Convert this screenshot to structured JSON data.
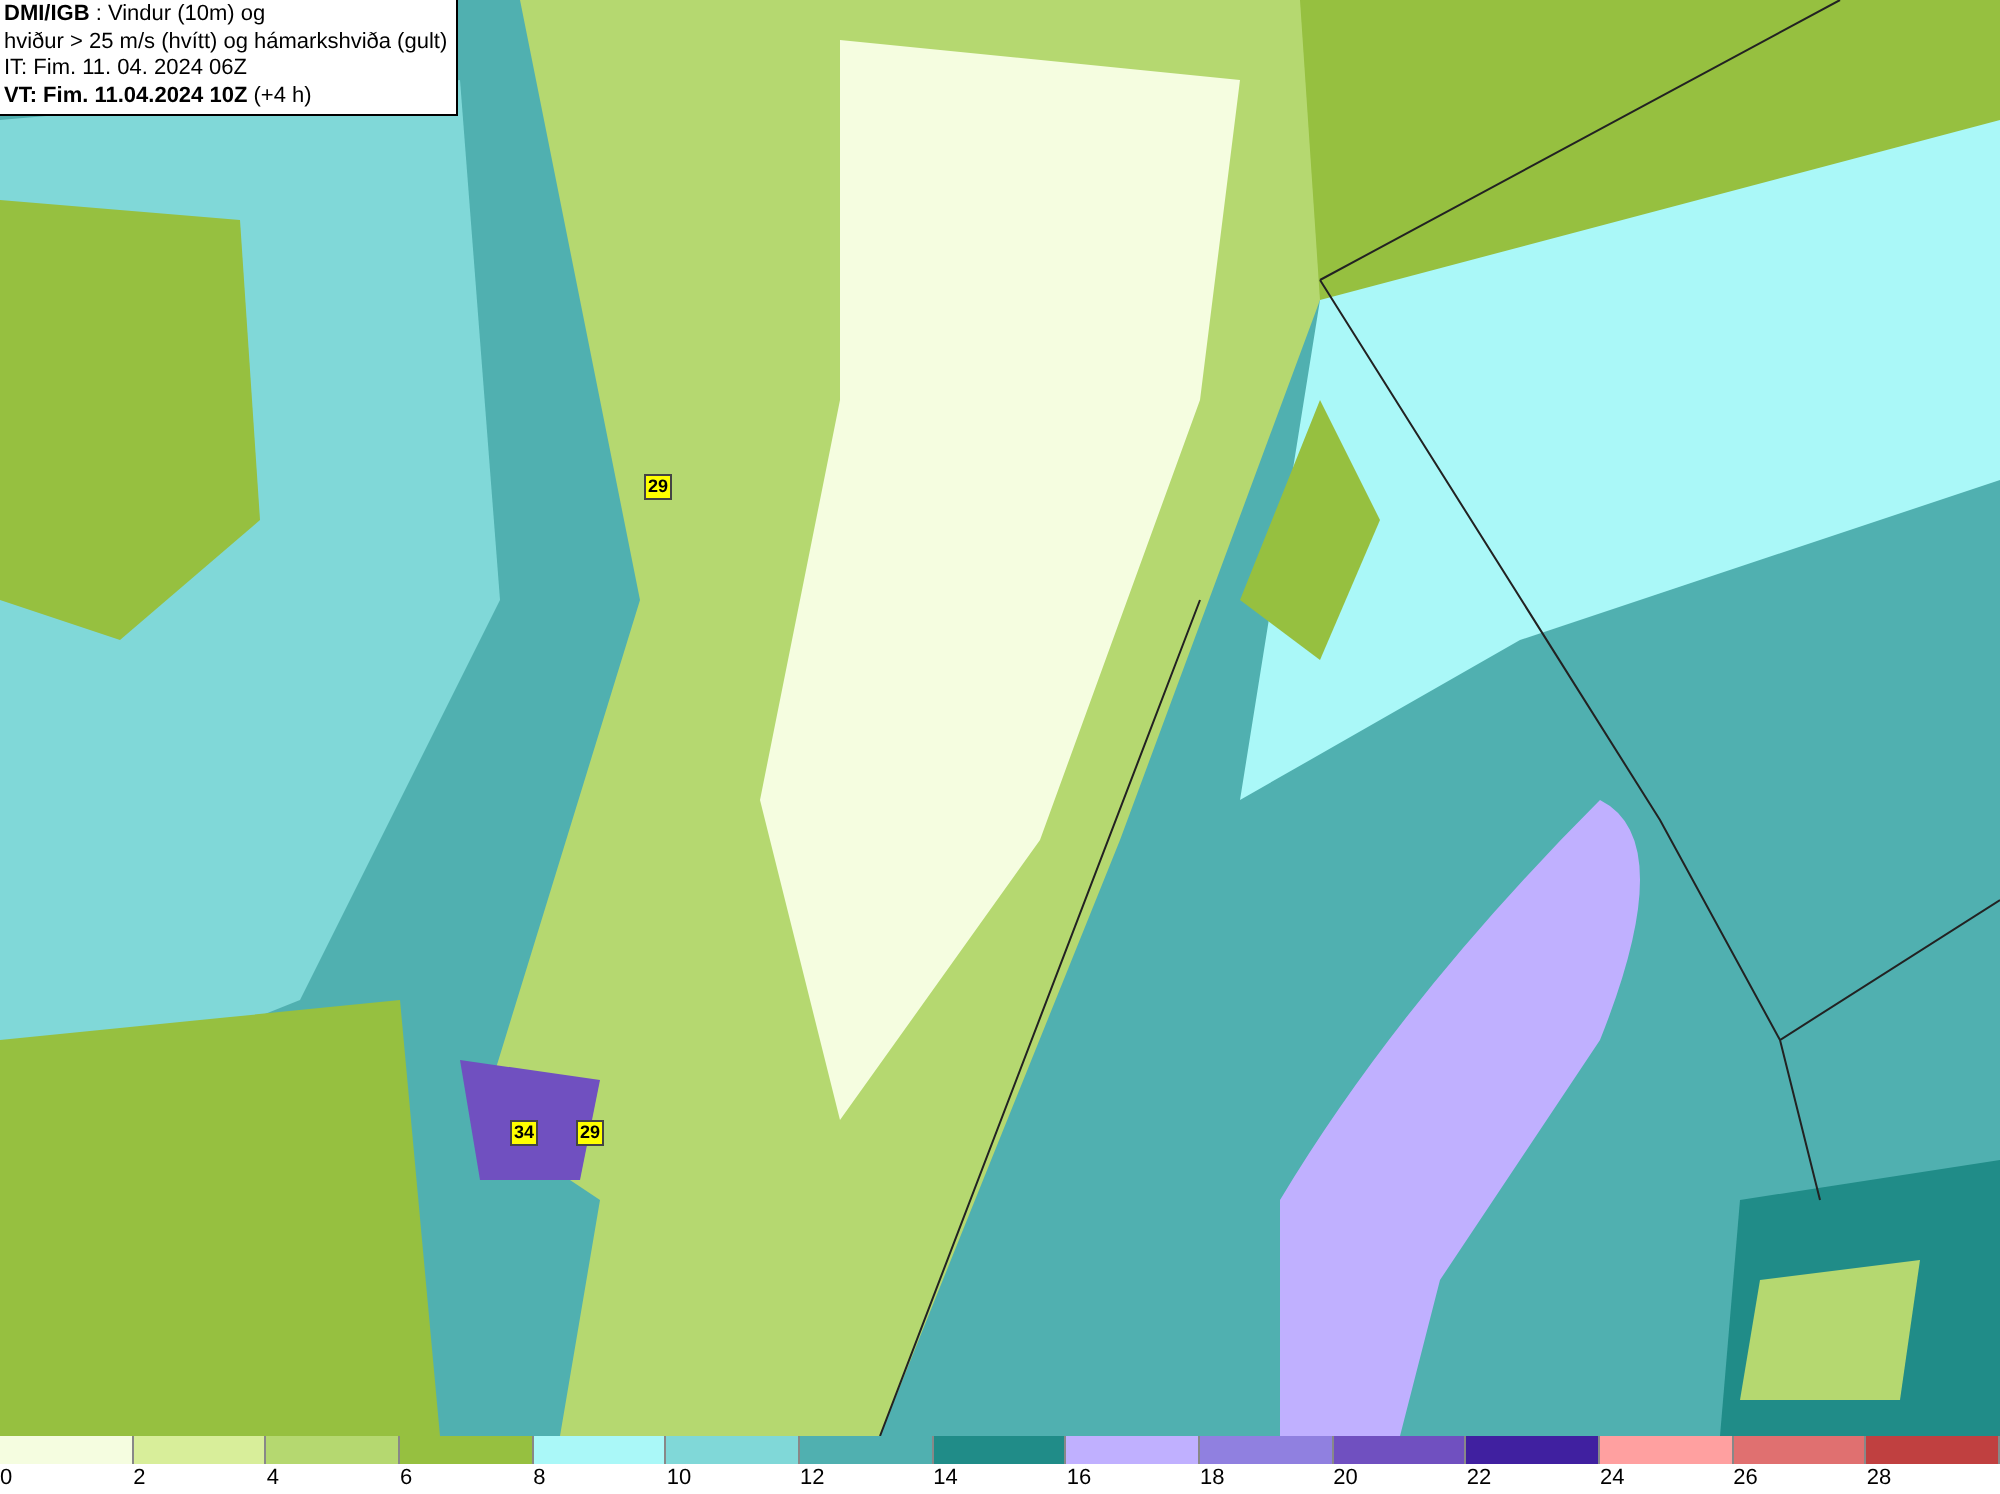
{
  "header": {
    "lines": [
      "**DMI/IGB** : Vindur (10m) og",
      "hviður > 25 m/s (hvítt) og hámarkshviða (gult)",
      "IT: Fim. 11. 04. 2024 06Z",
      "**VT: Fim. 11.04.2024 10Z** (+4 h)"
    ]
  },
  "gust_labels": [
    {
      "value": "29"
    },
    {
      "value": "34"
    },
    {
      "value": "29"
    }
  ],
  "legend": [
    {
      "label": "0",
      "color": "#f5fde0"
    },
    {
      "label": "2",
      "color": "#d8ee9a"
    },
    {
      "label": "4",
      "color": "#b5d870"
    },
    {
      "label": "6",
      "color": "#96c040"
    },
    {
      "label": "8",
      "color": "#aaf8f8"
    },
    {
      "label": "10",
      "color": "#80d8d8"
    },
    {
      "label": "12",
      "color": "#50b0b0"
    },
    {
      "label": "14",
      "color": "#208c88"
    },
    {
      "label": "16",
      "color": "#c0b0ff"
    },
    {
      "label": "18",
      "color": "#9080e0"
    },
    {
      "label": "20",
      "color": "#7050c0"
    },
    {
      "label": "22",
      "color": "#4020a0"
    },
    {
      "label": "24",
      "color": "#ffa0a0"
    },
    {
      "label": "26",
      "color": "#e07070"
    },
    {
      "label": "28",
      "color": "#c04040"
    }
  ]
}
